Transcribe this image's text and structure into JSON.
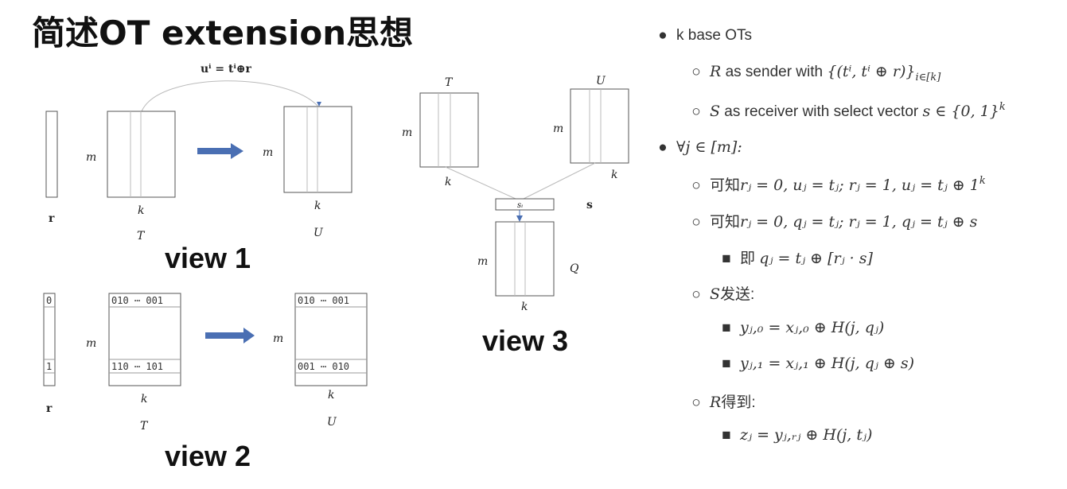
{
  "title": "简述OT extension思想",
  "views": {
    "view1": "view 1",
    "view2": "view 2",
    "view3": "view 3"
  },
  "diagram": {
    "formula": "uⁱ = tⁱ⊕r",
    "m": "m",
    "k": "k",
    "r": "r",
    "T": "T",
    "U": "U",
    "Q": "Q",
    "s": "s",
    "si": "sᵢ",
    "bit0": "0",
    "bit1": "1",
    "t_row_top": "010 ⋯ 001",
    "t_row_bottom": "110 ⋯ 101",
    "u_row_top": "010 ⋯ 001",
    "u_row_bottom": "001 ⋯ 010"
  },
  "bullets": {
    "b1": "k base OTs",
    "b1_1_pre": "R",
    "b1_1_text": " as sender with ",
    "b1_1_math": "{(tⁱ, tⁱ ⊕ r)}",
    "b1_1_sub": "i∈[k]",
    "b1_2_pre": "S",
    "b1_2_text": " as receiver with select vector ",
    "b1_2_math": "s ∈ {0, 1}",
    "b1_2_sup": "k",
    "b2": "∀j ∈ [m]:",
    "b2_1_pre": "可知",
    "b2_1_math": "rⱼ = 0, uⱼ = tⱼ; rⱼ = 1, uⱼ = tⱼ ⊕ 1",
    "b2_1_sup": "k",
    "b2_2_pre": "可知",
    "b2_2_math": "rⱼ = 0, qⱼ = tⱼ; rⱼ = 1, qⱼ = tⱼ ⊕ s",
    "b2_2_1_pre": "即 ",
    "b2_2_1_math": "qⱼ = tⱼ ⊕ [rⱼ · s]",
    "b2_3_pre": "S",
    "b2_3_text": "发送:",
    "b2_3_1": "yⱼ,₀ = xⱼ,₀ ⊕ H(j, qⱼ)",
    "b2_3_2": "yⱼ,₁ = xⱼ,₁ ⊕ H(j, qⱼ ⊕ s)",
    "b2_4_pre": "R",
    "b2_4_text": "得到:",
    "b2_4_1": "zⱼ = yⱼ,ᵣⱼ ⊕ H(j, tⱼ)"
  }
}
